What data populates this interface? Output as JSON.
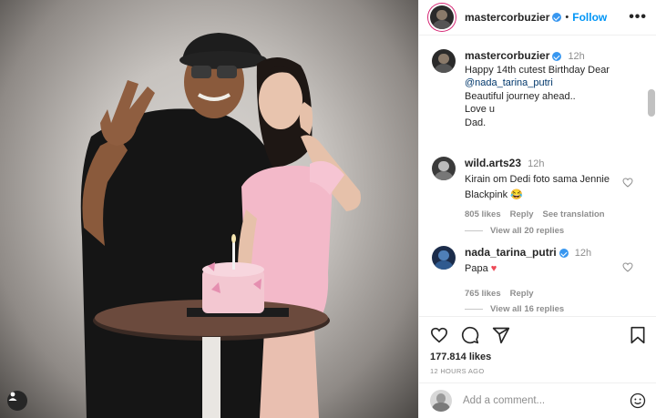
{
  "post": {
    "author": "mastercorbuzier",
    "follow_label": "Follow",
    "more_label": "•••",
    "caption": {
      "username": "mastercorbuzier",
      "time": "12h",
      "lines": [
        "Happy 14th cutest Birthday Dear",
        "@nada_tarina_putri",
        "Beautiful journey ahead..",
        "Love u",
        "Dad."
      ]
    },
    "comments": [
      {
        "username": "wild.arts23",
        "time": "12h",
        "text_line1": "Kirain om Dedi foto sama Jennie",
        "text_line2": "Blackpink",
        "emoji": "😂",
        "likes": "805 likes",
        "reply": "Reply",
        "translate": "See translation",
        "view_replies": "View all 20 replies"
      },
      {
        "username": "nada_tarina_putri",
        "time": "12h",
        "text": "Papa",
        "emoji": "♥",
        "likes": "765 likes",
        "reply": "Reply",
        "view_replies": "View all 16 replies"
      }
    ],
    "likes_count": "177.814 likes",
    "time_ago": "12 HOURS AGO",
    "add_comment_placeholder": "Add a comment...",
    "separator": "•"
  },
  "colors": {
    "accent": "#0095f6",
    "verified": "#3897f0",
    "heart_red": "#ed4956",
    "muted": "#8e8e8e"
  },
  "icons": [
    "verified-badge-icon",
    "more-options-icon",
    "heart-icon",
    "comment-icon",
    "share-icon",
    "bookmark-icon",
    "emoji-icon",
    "user-tag-icon"
  ]
}
